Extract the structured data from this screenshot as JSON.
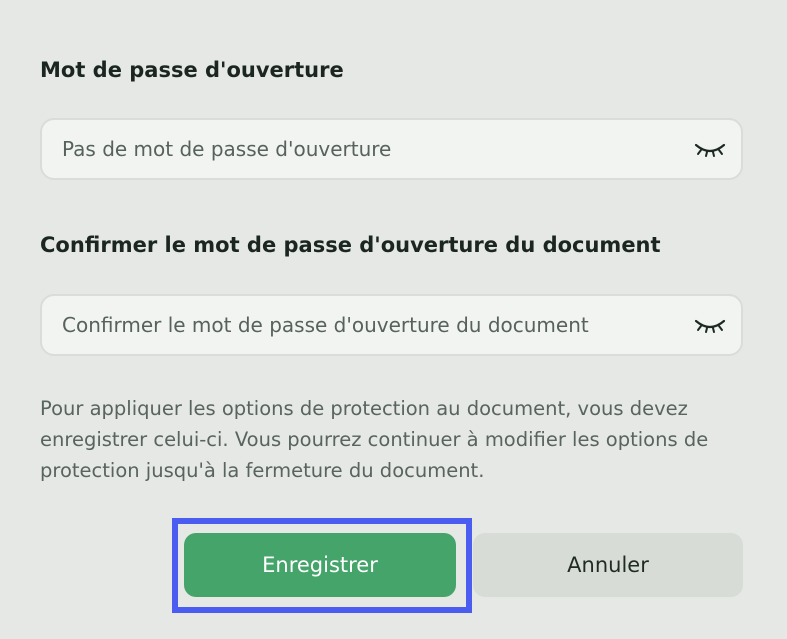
{
  "open_password": {
    "label": "Mot de passe d'ouverture",
    "value": "",
    "placeholder": "Pas de mot de passe d'ouverture",
    "visibility_icon": "eye-closed-icon"
  },
  "confirm_password": {
    "label": "Confirmer le mot de passe d'ouverture du document",
    "value": "",
    "placeholder": "Confirmer le mot de passe d'ouverture du document",
    "visibility_icon": "eye-closed-icon"
  },
  "note": "Pour appliquer les options de protection au document, vous devez enregistrer celui-ci. Vous pourrez continuer à modifier les options de protection jusqu'à la fermeture du document.",
  "actions": {
    "save_label": "Enregistrer",
    "cancel_label": "Annuler"
  },
  "colors": {
    "background": "#e5e8e4",
    "primary": "#45a46a",
    "focus_ring": "#4a5df0"
  }
}
